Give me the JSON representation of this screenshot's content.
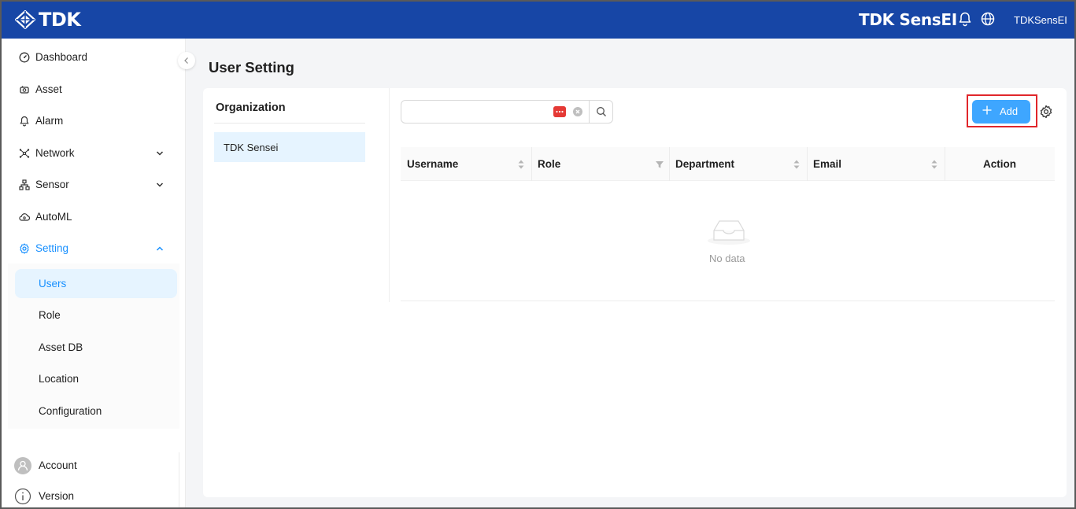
{
  "header": {
    "logo_text": "TDK",
    "app_title": "TDK SensEI",
    "user_name": "TDKSensEI",
    "bg_color": "#1746a6"
  },
  "sidebar": {
    "items": [
      {
        "label": "Dashboard",
        "icon": "dashboard-icon"
      },
      {
        "label": "Asset",
        "icon": "asset-icon"
      },
      {
        "label": "Alarm",
        "icon": "bell-icon"
      },
      {
        "label": "Network",
        "icon": "network-icon",
        "expandable": true
      },
      {
        "label": "Sensor",
        "icon": "sensor-icon",
        "expandable": true
      },
      {
        "label": "AutoML",
        "icon": "automl-icon"
      },
      {
        "label": "Setting",
        "icon": "gear-icon",
        "expanded": true
      }
    ],
    "sub_items": [
      {
        "label": "Users",
        "selected": true
      },
      {
        "label": "Role"
      },
      {
        "label": "Asset DB"
      },
      {
        "label": "Location"
      },
      {
        "label": "Configuration"
      }
    ],
    "bottom": [
      {
        "label": "Account",
        "icon": "avatar-icon"
      },
      {
        "label": "Version",
        "icon": "info-icon"
      }
    ],
    "accent_color": "#1890ff"
  },
  "main": {
    "page_title": "User Setting",
    "organization": {
      "title": "Organization",
      "items": [
        {
          "label": "TDK Sensei",
          "selected": true
        }
      ]
    },
    "search": {
      "value": "",
      "placeholder": ""
    },
    "add_button_label": "Add",
    "table": {
      "columns": [
        "Username",
        "Role",
        "Department",
        "Email",
        "Action"
      ],
      "empty_text": "No data"
    }
  }
}
